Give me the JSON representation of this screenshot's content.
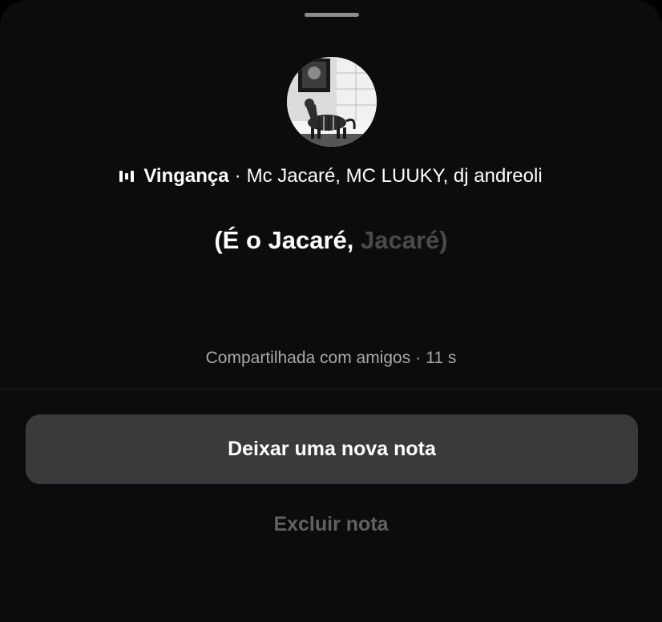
{
  "note": {
    "music": {
      "icon": "music-bars-icon",
      "song": "Vingança",
      "separator": "·",
      "artists": "Mc Jacaré, MC LUUKY, dj andreoli"
    },
    "lyric": {
      "highlighted": "(É o Jacaré,",
      "upcoming": "Jacaré)"
    },
    "shared_label": "Compartilhada com amigos",
    "meta_separator": "·",
    "time_ago": "11 s"
  },
  "actions": {
    "new_note_label": "Deixar uma nova nota",
    "delete_label": "Excluir nota"
  },
  "colors": {
    "sheet_background": "#0c0c0d",
    "primary_button": "#3a3a3c",
    "lyric_upcoming": "#4a4a4c",
    "meta_text": "#a8a8a8",
    "delete_text": "#616163"
  }
}
